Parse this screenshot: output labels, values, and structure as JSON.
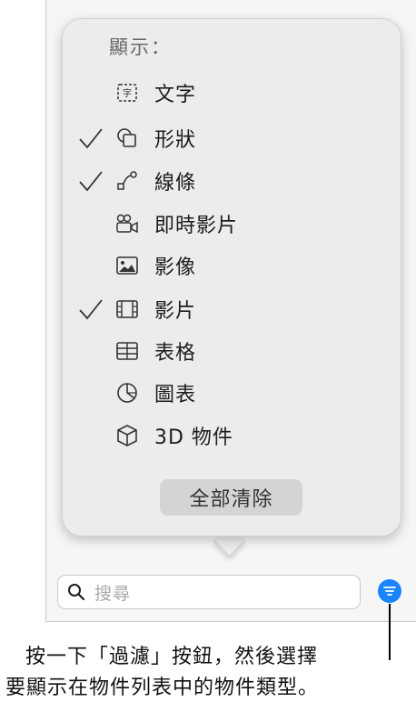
{
  "popover": {
    "title": "顯示：",
    "items": [
      {
        "label": "文字",
        "checked": false,
        "icon": "text-box-icon"
      },
      {
        "label": "形狀",
        "checked": true,
        "icon": "shapes-icon"
      },
      {
        "label": "線條",
        "checked": true,
        "icon": "line-icon"
      },
      {
        "label": "即時影片",
        "checked": false,
        "icon": "live-video-icon"
      },
      {
        "label": "影像",
        "checked": false,
        "icon": "image-icon"
      },
      {
        "label": "影片",
        "checked": true,
        "icon": "film-icon"
      },
      {
        "label": "表格",
        "checked": false,
        "icon": "table-icon"
      },
      {
        "label": "圖表",
        "checked": false,
        "icon": "chart-icon"
      },
      {
        "label": "3D 物件",
        "checked": false,
        "icon": "cube-icon"
      }
    ],
    "clear_button": "全部清除"
  },
  "search": {
    "placeholder": "搜尋"
  },
  "caption": {
    "line1": "按一下「過濾」按鈕，然後選擇",
    "line2": "要顯示在物件列表中的物件類型。"
  },
  "colors": {
    "accent": "#1a84ff"
  }
}
